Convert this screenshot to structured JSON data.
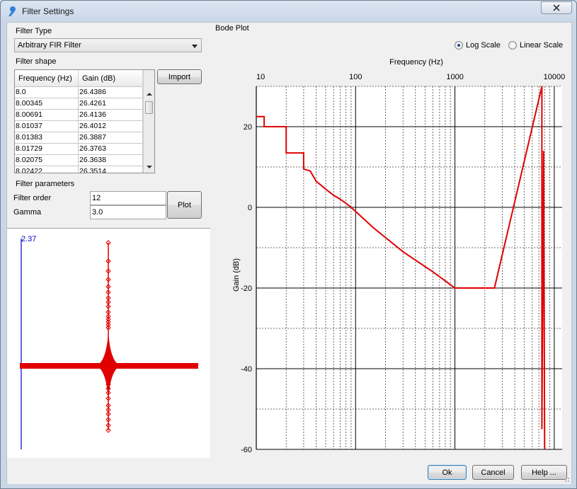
{
  "window": {
    "title": "Filter Settings"
  },
  "filter_type": {
    "label": "Filter Type",
    "selected": "Arbitrary FIR Filter"
  },
  "filter_shape": {
    "label": "Filter shape",
    "columns": [
      "Frequency (Hz)",
      "Gain (dB)"
    ],
    "rows": [
      [
        "8.0",
        "26.4386"
      ],
      [
        "8.00345",
        "26.4261"
      ],
      [
        "8.00691",
        "26.4136"
      ],
      [
        "8.01037",
        "26.4012"
      ],
      [
        "8.01383",
        "26.3887"
      ],
      [
        "8.01729",
        "26.3763"
      ],
      [
        "8.02075",
        "26.3638"
      ],
      [
        "8.02422",
        "26.3514"
      ]
    ],
    "import_label": "Import"
  },
  "filter_params": {
    "label": "Filter parameters",
    "order_label": "Filter order",
    "order_value": "12",
    "gamma_label": "Gamma",
    "gamma_value": "3.0",
    "plot_label": "Plot"
  },
  "impulse": {
    "max_label": "2.37"
  },
  "bode": {
    "label": "Bode Plot",
    "log_scale_label": "Log Scale",
    "linear_scale_label": "Linear Scale",
    "selected_scale": "log"
  },
  "buttons": {
    "ok": "Ok",
    "cancel": "Cancel",
    "help": "Help ..."
  },
  "chart_data": {
    "type": "line",
    "title": "",
    "xlabel": "Frequency (Hz)",
    "ylabel": "Gain (dB)",
    "x_scale": "log",
    "xlim": [
      10,
      12000
    ],
    "ylim": [
      -60,
      30
    ],
    "x_ticks": [
      "10",
      "100",
      "1000",
      "10000"
    ],
    "y_ticks": [
      "20",
      "0",
      "-20",
      "-40",
      "-60"
    ],
    "grid": true,
    "series": [
      {
        "color": "#e00000",
        "x": [
          10,
          12,
          12,
          20,
          20,
          25,
          30,
          30,
          35,
          40,
          50,
          60,
          70,
          80,
          90,
          100,
          150,
          300,
          600,
          1000,
          2500,
          7500,
          7500,
          7800,
          8000
        ],
        "y": [
          22.5,
          22.5,
          20,
          20,
          13.5,
          13.5,
          13.5,
          9.5,
          9,
          6.5,
          4.5,
          3,
          2,
          1,
          0,
          -1,
          -5,
          -11,
          -16,
          -20,
          -20,
          30,
          -55,
          14,
          -60
        ]
      }
    ]
  },
  "colors": {
    "curve": "#e00000",
    "impulse_axis": "#0000c8"
  }
}
